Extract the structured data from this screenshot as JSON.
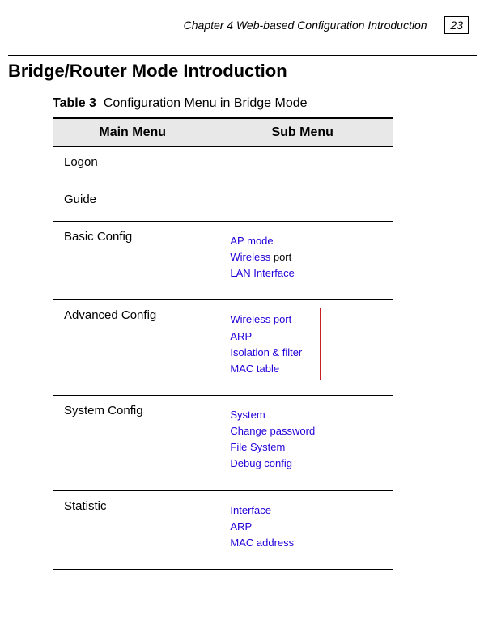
{
  "header": {
    "chapter": "Chapter 4 Web-based Configuration Introduction",
    "page_number": "23"
  },
  "section_title": "Bridge/Router Mode Introduction",
  "table": {
    "caption_label": "Table 3",
    "caption_text": "Configuration Menu in Bridge Mode",
    "col_headers": {
      "main": "Main Menu",
      "sub": "Sub Menu"
    },
    "rows": [
      {
        "main": "Logon",
        "sub": []
      },
      {
        "main": "Guide",
        "sub": []
      },
      {
        "main": "Basic Config",
        "sub": [
          "AP mode",
          "Wireless port",
          "LAN Interface"
        ]
      },
      {
        "main": "Advanced Config",
        "sub": [
          "Wireless port",
          "ARP",
          "Isolation & filter",
          "MAC table"
        ],
        "red_bar": true
      },
      {
        "main": "System Config",
        "sub": [
          "System",
          "Change password",
          "File System",
          "Debug config"
        ]
      },
      {
        "main": "Statistic",
        "sub": [
          "Interface",
          "ARP",
          "MAC address"
        ]
      }
    ]
  }
}
